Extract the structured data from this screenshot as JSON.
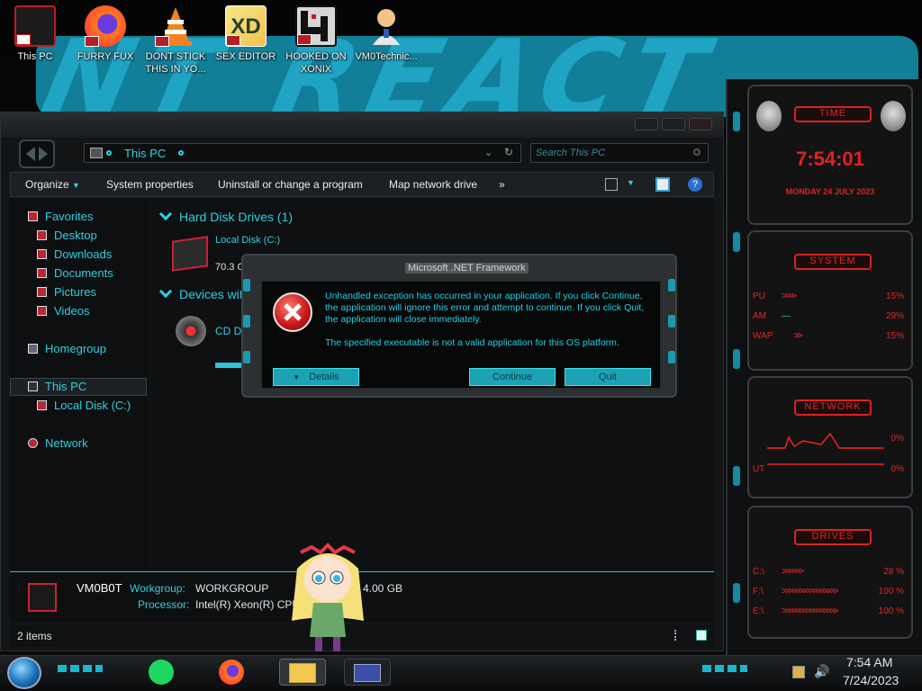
{
  "desktop_icons": [
    {
      "label": "This PC",
      "icon": "computer-icon"
    },
    {
      "label": "FURRY FUX",
      "icon": "firefox-icon"
    },
    {
      "label": "DONT STICK THIS IN YO...",
      "icon": "vlc-cone-icon"
    },
    {
      "label": "SEX EDITOR",
      "icon": "xd-editor-icon"
    },
    {
      "label": "HOOKED ON XONIX",
      "icon": "xonix-game-icon"
    },
    {
      "label": "VM0Technic...",
      "icon": "technician-user-icon"
    }
  ],
  "wallpaper": {
    "text": "NT REACT"
  },
  "explorer": {
    "address": "This PC",
    "search_placeholder": "Search This PC",
    "commands": [
      "Organize",
      "System properties",
      "Uninstall or change a program",
      "Map network drive",
      "»"
    ],
    "nav": {
      "favorites": "Favorites",
      "favorites_items": [
        "Desktop",
        "Downloads",
        "Documents",
        "Pictures",
        "Videos"
      ],
      "homegroup": "Homegroup",
      "this_pc": "This PC",
      "this_pc_items": [
        "Local Disk (C:)"
      ],
      "network": "Network"
    },
    "content": {
      "group_hdd": "Hard Disk Drives (1)",
      "local_disk_label": "Local Disk (C:)",
      "local_disk_free": "70.3 G",
      "local_disk_used_fraction": 0.55,
      "group_devices": "Devices with",
      "cd_drive_label": "CD Dri"
    },
    "details": {
      "computer_name": "VM0B0T",
      "workgroup_label": "Workgroup:",
      "workgroup_value": "WORKGROUP",
      "processor_label": "Processor:",
      "processor_value": "Intel(R) Xeon(R) CPU",
      "memory_value": "4.00 GB"
    },
    "status": {
      "items": "2 items"
    }
  },
  "dialog": {
    "title": "Microsoft .NET Framework",
    "message1": "Unhandled exception has occurred in your application. If you click Continue, the application will ignore this error and attempt to continue. If you click Quit, the application will close immediately.",
    "message2": "The specified executable is not a valid application for this OS platform.",
    "details_label": "Details",
    "continue_label": "Continue",
    "quit_label": "Quit"
  },
  "gadgets": {
    "time": {
      "title": "TIME",
      "clock": "7:54:01",
      "date": "MONDAY 24 JULY 2023"
    },
    "system": {
      "title": "SYSTEM",
      "rows": [
        {
          "label": "PU",
          "value": "15%"
        },
        {
          "label": "AM",
          "value": "29%"
        },
        {
          "label": "WAP",
          "value": "15%"
        }
      ]
    },
    "network": {
      "title": "NETWORK",
      "rows": [
        {
          "label": "",
          "value": "0%"
        },
        {
          "label": "UT",
          "value": "0%"
        }
      ]
    },
    "drives": {
      "title": "DRIVES",
      "rows": [
        {
          "label": "C:\\",
          "value": "28 %"
        },
        {
          "label": "F:\\",
          "value": "100 %"
        },
        {
          "label": "E:\\",
          "value": "100 %"
        }
      ]
    }
  },
  "taskbar": {
    "apps": [
      "spotify-icon",
      "firefox-icon",
      "file-explorer-icon",
      "control-panel-icon"
    ],
    "time": "7:54 AM",
    "date": "7/24/2023"
  },
  "colors": {
    "accent": "#2fd0e3",
    "error": "#c4151a",
    "gadget_red": "#e02626"
  }
}
